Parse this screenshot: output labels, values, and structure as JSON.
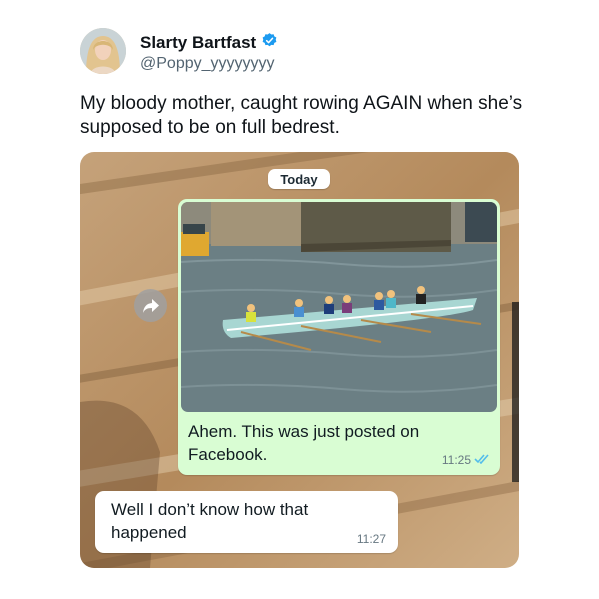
{
  "tweet": {
    "display_name": "Slarty Bartfast",
    "handle": "@Poppy_yyyyyyyy",
    "text": "My bloody mother, caught rowing AGAIN when she’s supposed to be on full bedrest.",
    "verified_color": "#1d9bf0"
  },
  "chat": {
    "date_separator": "Today",
    "messages": [
      {
        "direction": "outgoing",
        "text": "Ahem. This was just posted on Facebook.",
        "time": "11:25",
        "status": "read",
        "has_photo": true
      },
      {
        "direction": "incoming",
        "text": "Well I don’t know how that happened",
        "time": "11:27"
      }
    ],
    "colors": {
      "outgoing_bubble": "#d9fdd3",
      "incoming_bubble": "#ffffff",
      "read_ticks": "#53bdeb"
    }
  },
  "icons": [
    "verified-badge-icon",
    "forward-icon",
    "double-check-icon"
  ]
}
